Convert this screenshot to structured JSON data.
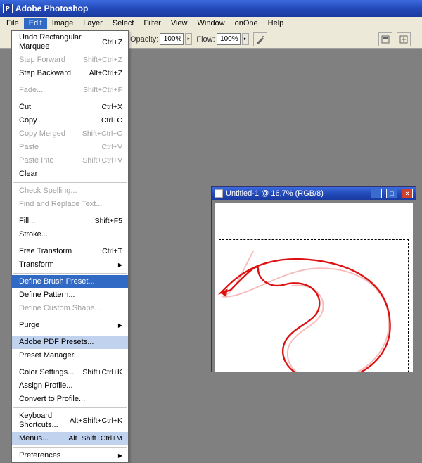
{
  "app": {
    "title": "Adobe Photoshop"
  },
  "menubar": {
    "items": [
      "File",
      "Edit",
      "Image",
      "Layer",
      "Select",
      "Filter",
      "View",
      "Window",
      "onOne",
      "Help"
    ],
    "open_index": 1
  },
  "options": {
    "opacity_label": "Opacity:",
    "opacity_value": "100%",
    "flow_label": "Flow:",
    "flow_value": "100%"
  },
  "edit_menu": {
    "groups": [
      [
        {
          "label": "Undo Rectangular Marquee",
          "shortcut": "Ctrl+Z",
          "disabled": false
        },
        {
          "label": "Step Forward",
          "shortcut": "Shift+Ctrl+Z",
          "disabled": true
        },
        {
          "label": "Step Backward",
          "shortcut": "Alt+Ctrl+Z",
          "disabled": false
        }
      ],
      [
        {
          "label": "Fade...",
          "shortcut": "Shift+Ctrl+F",
          "disabled": true
        }
      ],
      [
        {
          "label": "Cut",
          "shortcut": "Ctrl+X",
          "disabled": false
        },
        {
          "label": "Copy",
          "shortcut": "Ctrl+C",
          "disabled": false
        },
        {
          "label": "Copy Merged",
          "shortcut": "Shift+Ctrl+C",
          "disabled": true
        },
        {
          "label": "Paste",
          "shortcut": "Ctrl+V",
          "disabled": true
        },
        {
          "label": "Paste Into",
          "shortcut": "Shift+Ctrl+V",
          "disabled": true
        },
        {
          "label": "Clear",
          "shortcut": "",
          "disabled": false
        }
      ],
      [
        {
          "label": "Check Spelling...",
          "shortcut": "",
          "disabled": true
        },
        {
          "label": "Find and Replace Text...",
          "shortcut": "",
          "disabled": true
        }
      ],
      [
        {
          "label": "Fill...",
          "shortcut": "Shift+F5",
          "disabled": false
        },
        {
          "label": "Stroke...",
          "shortcut": "",
          "disabled": false
        }
      ],
      [
        {
          "label": "Free Transform",
          "shortcut": "Ctrl+T",
          "disabled": false
        },
        {
          "label": "Transform",
          "shortcut": "",
          "disabled": false,
          "submenu": true
        }
      ],
      [
        {
          "label": "Define Brush Preset...",
          "shortcut": "",
          "disabled": false,
          "highlight": true
        },
        {
          "label": "Define Pattern...",
          "shortcut": "",
          "disabled": false
        },
        {
          "label": "Define Custom Shape...",
          "shortcut": "",
          "disabled": true
        }
      ],
      [
        {
          "label": "Purge",
          "shortcut": "",
          "disabled": false,
          "submenu": true
        }
      ],
      [
        {
          "label": "Adobe PDF Presets...",
          "shortcut": "",
          "disabled": false,
          "hover": true
        },
        {
          "label": "Preset Manager...",
          "shortcut": "",
          "disabled": false
        }
      ],
      [
        {
          "label": "Color Settings...",
          "shortcut": "Shift+Ctrl+K",
          "disabled": false
        },
        {
          "label": "Assign Profile...",
          "shortcut": "",
          "disabled": false
        },
        {
          "label": "Convert to Profile...",
          "shortcut": "",
          "disabled": false
        }
      ],
      [
        {
          "label": "Keyboard Shortcuts...",
          "shortcut": "Alt+Shift+Ctrl+K",
          "disabled": false
        },
        {
          "label": "Menus...",
          "shortcut": "Alt+Shift+Ctrl+M",
          "disabled": false,
          "hover": true
        }
      ],
      [
        {
          "label": "Preferences",
          "shortcut": "",
          "disabled": false,
          "submenu": true
        }
      ]
    ]
  },
  "document": {
    "title": "Untitled-1 @ 16,7% (RGB/8)"
  }
}
